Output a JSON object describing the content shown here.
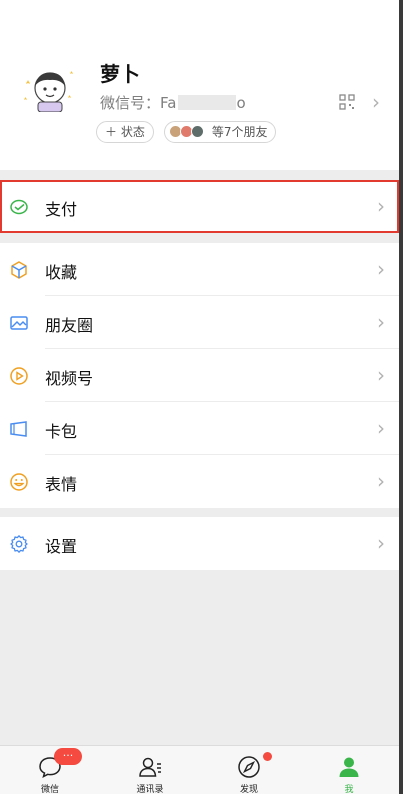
{
  "profile": {
    "nickname": "萝卜",
    "wechat_id_label": "微信号：Fa",
    "wechat_id_suffix": "o",
    "status_button": "＋ 状态",
    "friends_status": "等7个朋友",
    "icons": [
      "avatar",
      "qr-code-icon",
      "chevron-right-icon"
    ]
  },
  "menu": {
    "pay": "支付",
    "favorites": "收藏",
    "moments": "朋友圈",
    "channels": "视频号",
    "cards": "卡包",
    "stickers": "表情",
    "settings": "设置"
  },
  "tabbar": {
    "chats": "微信",
    "chats_badge": "···",
    "contacts": "通讯录",
    "discover": "发现",
    "me": "我"
  },
  "colors": {
    "accent_green": "#39b54a",
    "badge_red": "#f44a3f",
    "highlight_border": "#e23a2e",
    "background": "#ededed"
  }
}
